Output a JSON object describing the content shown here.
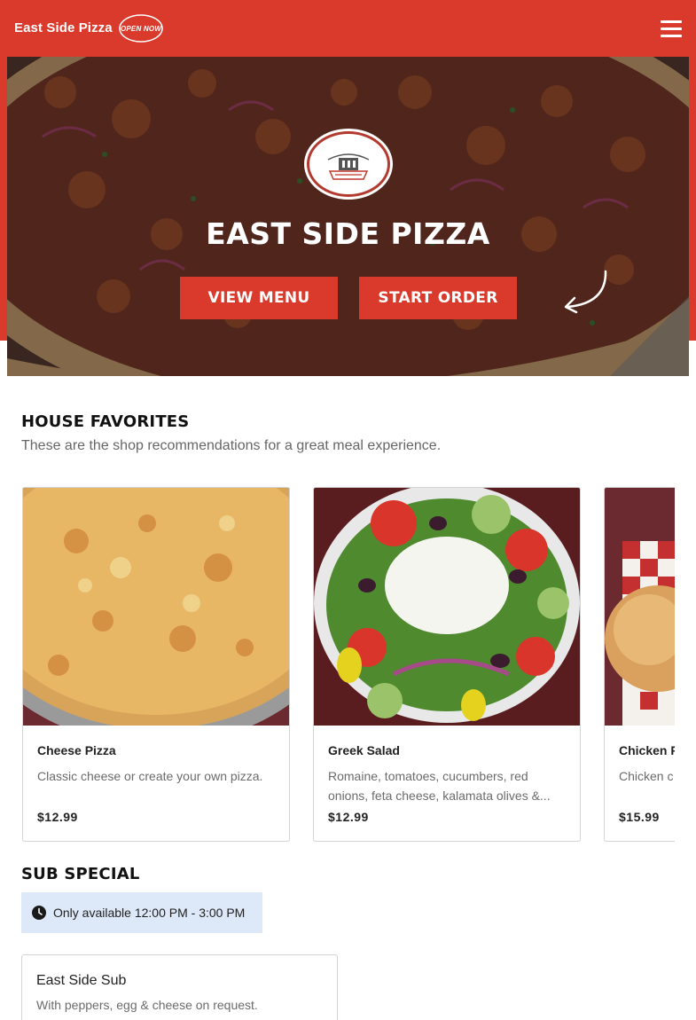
{
  "header": {
    "brand": "East Side Pizza",
    "badge": "OPEN NOW",
    "menu_icon": "hamburger-menu-icon"
  },
  "hero": {
    "title": "EAST SIDE PIZZA",
    "view_menu_label": "VIEW MENU",
    "start_order_label": "START ORDER",
    "logo_text": "EAST SIDE PIZZA"
  },
  "favorites": {
    "title": "HOUSE FAVORITES",
    "subtitle": "These are the shop recommendations for a great meal experience.",
    "items": [
      {
        "name": "Cheese Pizza",
        "description": "Classic cheese or create your own pizza.",
        "price": "$12.99"
      },
      {
        "name": "Greek Salad",
        "description": "Romaine, tomatoes, cucumbers, red onions, feta cheese, kalamata olives &...",
        "price": "$12.99"
      },
      {
        "name": "Chicken P",
        "description": "Chicken c",
        "price": "$15.99"
      }
    ]
  },
  "sub_special": {
    "title": "SUB SPECIAL",
    "availability": "Only available 12:00 PM - 3:00 PM",
    "item": {
      "name": "East Side Sub",
      "description": "With peppers, egg & cheese on request."
    }
  },
  "colors": {
    "brand_red": "#d93a2b",
    "availability_bg": "#dde9f8"
  }
}
